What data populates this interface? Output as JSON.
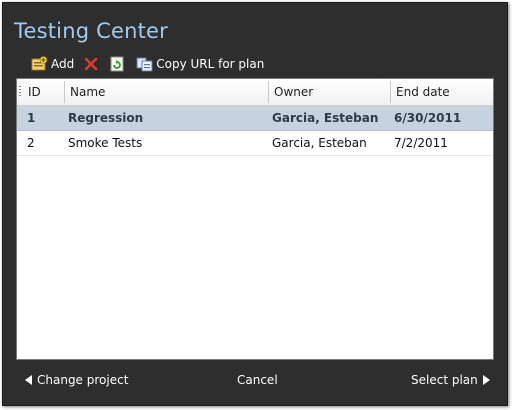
{
  "window": {
    "title": "Testing Center"
  },
  "toolbar": {
    "add_label": "Add",
    "copy_url_label": "Copy URL for plan",
    "icons": [
      "add-icon",
      "delete-icon",
      "refresh-icon",
      "copy-url-icon"
    ]
  },
  "table": {
    "columns": [
      "ID",
      "Name",
      "Owner",
      "End date"
    ],
    "rows": [
      {
        "id": "1",
        "name": "Regression",
        "owner": "Garcia, Esteban",
        "end_date": "6/30/2011",
        "selected": true
      },
      {
        "id": "2",
        "name": "Smoke Tests",
        "owner": "Garcia, Esteban",
        "end_date": "7/2/2011",
        "selected": false
      }
    ]
  },
  "footer": {
    "change_project_label": "Change project",
    "cancel_label": "Cancel",
    "select_plan_label": "Select plan"
  },
  "colors": {
    "background": "#2e2e2e",
    "title": "#9fcbf0",
    "selected_row": "#c6d3df",
    "delete_icon": "#e23b2a"
  }
}
